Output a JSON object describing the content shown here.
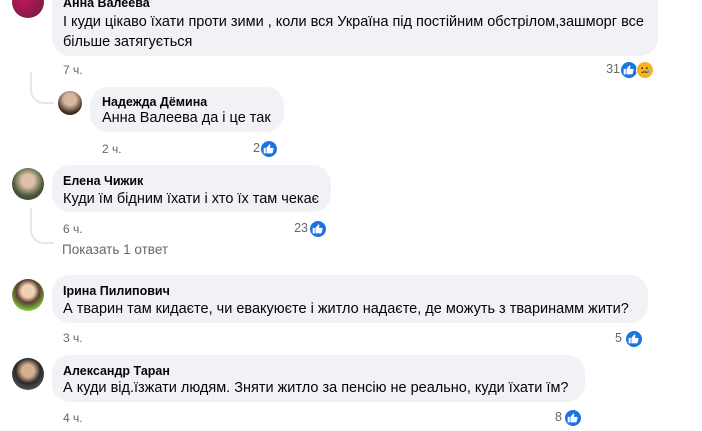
{
  "comments": [
    {
      "author": "Анна Валеева",
      "text": "І куди цікаво їхати проти зими , коли вся Україна під постійним обстрілом,зашморг все більше затягується",
      "time": "7 ч.",
      "reactions": "31",
      "reaction_icons": [
        "like-icon",
        "sad-icon"
      ]
    },
    {
      "author": "Надежда Дёмина",
      "mention": "Анна Валеева",
      "text": " да і це так",
      "time": "2 ч.",
      "reactions": "2",
      "reaction_icons": [
        "like-icon"
      ]
    },
    {
      "author": "Елена Чижик",
      "text": "Куди їм бідним їхати і хто їх там чекає",
      "time": "6 ч.",
      "reactions": "23",
      "reaction_icons": [
        "like-icon"
      ]
    },
    {
      "author": "Ірина Пилипович",
      "text": "А тварин там кидаєте, чи евакуюєте і житло надаєте, де можуть з тваринамм жити?",
      "time": "3 ч.",
      "reactions": "5",
      "reaction_icons": [
        "like-icon"
      ]
    },
    {
      "author": "Александр Таран",
      "text": "А куди від.їзжати людям. Зняти житло за пенсію не реально, куди їхати їм?",
      "time": "4 ч.",
      "reactions": "8",
      "reaction_icons": [
        "like-icon"
      ]
    }
  ],
  "show_replies": "Показать 1 ответ",
  "colors": {
    "bubble": "#f0f2f5",
    "like": "#1b74e4",
    "secondary_text": "#65676b"
  }
}
